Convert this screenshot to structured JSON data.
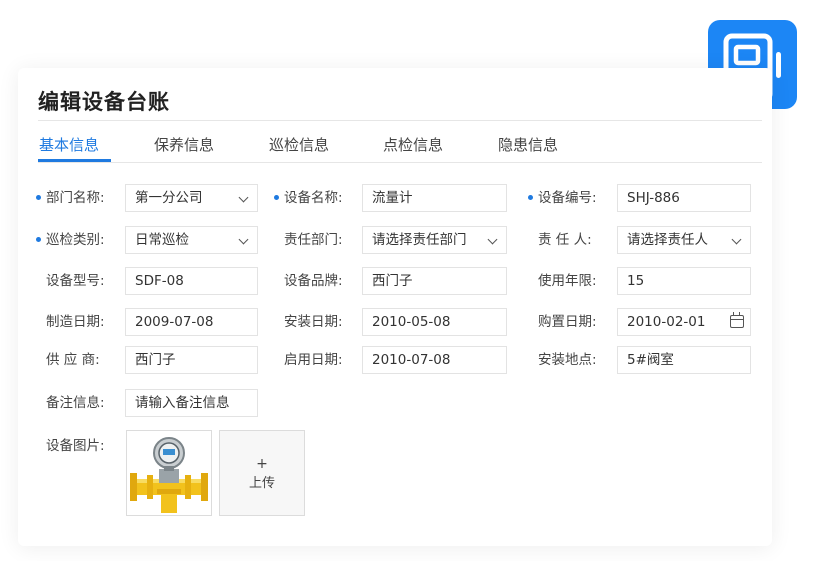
{
  "page": {
    "title": "编辑设备台账"
  },
  "tabs": [
    {
      "label": "基本信息",
      "active": true
    },
    {
      "label": "保养信息",
      "active": false
    },
    {
      "label": "巡检信息",
      "active": false
    },
    {
      "label": "点检信息",
      "active": false
    },
    {
      "label": "隐患信息",
      "active": false
    }
  ],
  "form": {
    "department": {
      "label": "部门名称:",
      "value": "第一分公司",
      "required": true
    },
    "device_name": {
      "label": "设备名称:",
      "value": "流量计",
      "required": true
    },
    "device_no": {
      "label": "设备编号:",
      "value": "SHJ-886",
      "required": true
    },
    "inspection_type": {
      "label": "巡检类别:",
      "value": "日常巡检",
      "required": true
    },
    "responsible_dept": {
      "label": "责任部门:",
      "placeholder": "请选择责任部门"
    },
    "responsible_person": {
      "label": "责 任 人:",
      "placeholder": "请选择责任人"
    },
    "model": {
      "label": "设备型号:",
      "value": "SDF-08"
    },
    "brand": {
      "label": "设备品牌:",
      "value": "西门子"
    },
    "service_life": {
      "label": "使用年限:",
      "value": "15"
    },
    "manufacture_date": {
      "label": "制造日期:",
      "value": "2009-07-08"
    },
    "install_date": {
      "label": "安装日期:",
      "value": "2010-05-08"
    },
    "purchase_date": {
      "label": "购置日期:",
      "value": "2010-02-01"
    },
    "supplier": {
      "label": "供 应 商:",
      "value": "西门子"
    },
    "enable_date": {
      "label": "启用日期:",
      "value": "2010-07-08"
    },
    "install_location": {
      "label": "安装地点:",
      "value": "5#阀室"
    },
    "remarks": {
      "label": "备注信息:",
      "placeholder": "请输入备注信息"
    },
    "images": {
      "label": "设备图片:",
      "upload_label": "上传",
      "upload_plus": "+"
    }
  },
  "colors": {
    "accent": "#1f7ae0",
    "app_icon": "#1c86f5"
  },
  "icons": [
    "chevron-down-icon",
    "calendar-icon",
    "device-ledger-app-icon",
    "plus-icon"
  ]
}
